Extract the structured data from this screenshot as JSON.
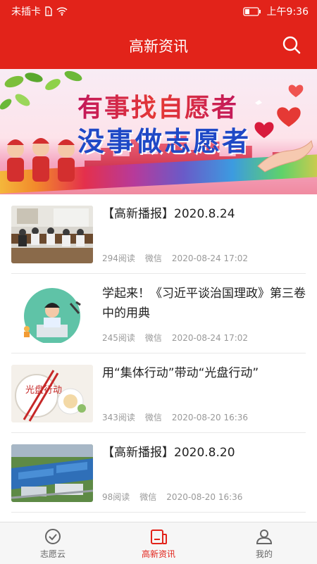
{
  "status_bar": {
    "carrier": "未插卡",
    "time": "上午9:36"
  },
  "header": {
    "title": "高新资讯"
  },
  "banner": {
    "line1": "有事找自愿者",
    "line2": "没事做志愿者"
  },
  "news": [
    {
      "title": "【高新播报】2020.8.24",
      "reads": "294阅读",
      "source": "微信",
      "time": "2020-08-24 17:02"
    },
    {
      "title": "学起来！《习近平谈治国理政》第三卷中的用典",
      "reads": "245阅读",
      "source": "微信",
      "time": "2020-08-24 17:02"
    },
    {
      "title": "用“集体行动”带动“光盘行动”",
      "reads": "343阅读",
      "source": "微信",
      "time": "2020-08-20 16:36"
    },
    {
      "title": "【高新播报】2020.8.20",
      "reads": "98阅读",
      "source": "微信",
      "time": "2020-08-20 16:36"
    }
  ],
  "tabs": [
    {
      "label": "志愿云"
    },
    {
      "label": "高新资讯"
    },
    {
      "label": "我的"
    }
  ],
  "thumb_text": {
    "guangpan": "光盘行动"
  },
  "colors": {
    "primary": "#e2231a"
  }
}
